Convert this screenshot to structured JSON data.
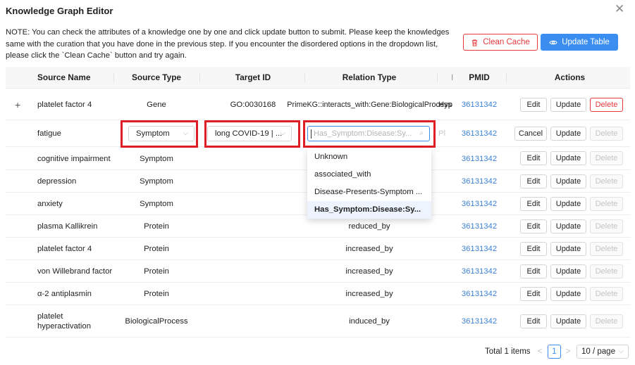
{
  "dialog": {
    "title": "Knowledge Graph Editor",
    "close_icon": "close-icon"
  },
  "note": "NOTE: You can check the attributes of a knowledge one by one and click update button to submit. Please keep the knowledges same with the curation that you have done in the previous step. If you encounter the disordered options in the dropdown list, please click the `Clean Cache` button and try again.",
  "toolbar": {
    "clean_label": "Clean Cache",
    "update_label": "Update Table",
    "clean_icon": "trash-icon",
    "update_icon": "eye-icon"
  },
  "columns": [
    "Source Name",
    "Source Type",
    "Target ID",
    "Relation Type",
    "I",
    "PMID",
    "Actions"
  ],
  "rows": [
    {
      "expand": "+",
      "source_name": "platelet factor 4",
      "source_type": "Gene",
      "target_id": "GO:0030168",
      "relation": "PrimeKG::interacts_with:Gene:BiologicalProcess",
      "extra": "Hyp",
      "pmid": "36131342",
      "actions": [
        "Edit",
        "Update",
        "Delete"
      ],
      "delete_state": "active"
    },
    {
      "source_name": "fatigue",
      "source_type": "Symptom",
      "target_id": "long COVID-19 | ...",
      "relation_placeholder": "Has_Symptom:Disease:Sy...",
      "extra": "Pl",
      "pmid": "36131342",
      "actions": [
        "Cancel",
        "Update",
        "Delete"
      ],
      "delete_state": "disabled",
      "editing": true
    },
    {
      "source_name": "cognitive impairment",
      "source_type": "Symptom",
      "target_id": "",
      "relation": "",
      "pmid": "36131342",
      "actions": [
        "Edit",
        "Update",
        "Delete"
      ],
      "delete_state": "disabled"
    },
    {
      "source_name": "depression",
      "source_type": "Symptom",
      "target_id": "",
      "relation": "",
      "pmid": "36131342",
      "actions": [
        "Edit",
        "Update",
        "Delete"
      ],
      "delete_state": "disabled"
    },
    {
      "source_name": "anxiety",
      "source_type": "Symptom",
      "target_id": "",
      "relation": "",
      "pmid": "36131342",
      "actions": [
        "Edit",
        "Update",
        "Delete"
      ],
      "delete_state": "disabled"
    },
    {
      "source_name": "plasma Kallikrein",
      "source_type": "Protein",
      "target_id": "",
      "relation": "reduced_by",
      "pmid": "36131342",
      "actions": [
        "Edit",
        "Update",
        "Delete"
      ],
      "delete_state": "disabled"
    },
    {
      "source_name": "platelet factor 4",
      "source_type": "Protein",
      "target_id": "",
      "relation": "increased_by",
      "pmid": "36131342",
      "actions": [
        "Edit",
        "Update",
        "Delete"
      ],
      "delete_state": "disabled"
    },
    {
      "source_name": "von Willebrand factor",
      "source_type": "Protein",
      "target_id": "",
      "relation": "increased_by",
      "pmid": "36131342",
      "actions": [
        "Edit",
        "Update",
        "Delete"
      ],
      "delete_state": "disabled"
    },
    {
      "source_name": "α-2 antiplasmin",
      "source_type": "Protein",
      "target_id": "",
      "relation": "increased_by",
      "pmid": "36131342",
      "actions": [
        "Edit",
        "Update",
        "Delete"
      ],
      "delete_state": "disabled"
    },
    {
      "source_name": "platelet hyperactivation",
      "source_type": "BiologicalProcess",
      "target_id": "",
      "relation": "induced_by",
      "pmid": "36131342",
      "actions": [
        "Edit",
        "Update",
        "Delete"
      ],
      "delete_state": "disabled"
    }
  ],
  "dropdown": {
    "options": [
      "Unknown",
      "associated_with",
      "Disease-Presents-Symptom ...",
      "Has_Symptom:Disease:Sy..."
    ],
    "active_index": 3
  },
  "pagination": {
    "total": "Total 1 items",
    "prev": "<",
    "page": "1",
    "next": ">",
    "page_size": "10 / page"
  },
  "colors": {
    "primary": "#3b8ef0",
    "danger": "#e5383b",
    "highlight": "#e01c24",
    "link": "#3b82d6"
  }
}
